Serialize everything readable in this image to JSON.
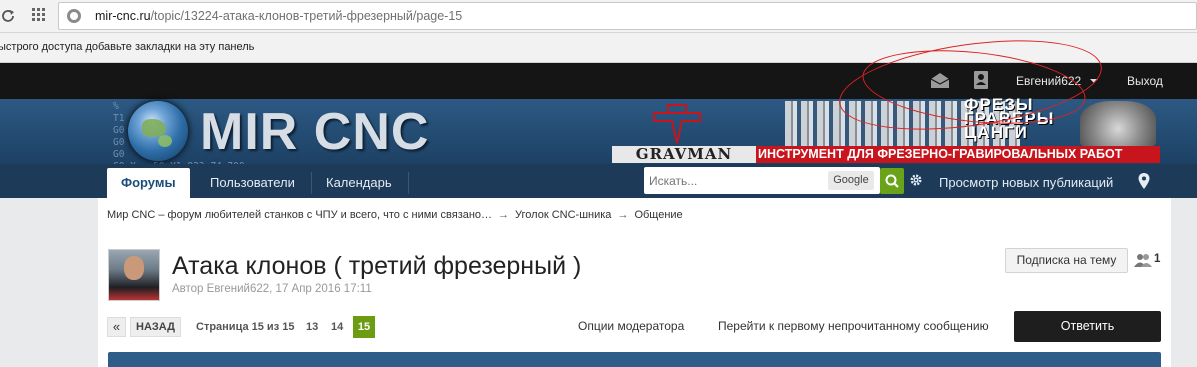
{
  "browser": {
    "url_domain": "mir-cnc.ru",
    "url_path": "/topic/13224-атака-клонов-третий-фрезерный/page-15",
    "bookmarks_hint": "ыстрого доступа добавьте закладки на эту панель"
  },
  "userbar": {
    "username": "Евгений622",
    "logout": "Выход"
  },
  "header": {
    "logo": "MIR CNC",
    "gcode_text": "%\nT1\nG0 \nG0 \nG0 \nG0 X   50 Y1.823 Z4.700",
    "ad_words": "ФРЕЗЫ\nГРАВЕРЫ\nЦАНГИ",
    "ad_brand": "GRAVMAN",
    "ad_tagline": "ИНСТРУМЕНТ ДЛЯ ФРЕЗЕРНО-ГРАВИРОВАЛЬНЫХ РАБОТ"
  },
  "nav": {
    "tabs": [
      {
        "label": "Форумы"
      },
      {
        "label": "Пользователи"
      },
      {
        "label": "Календарь"
      }
    ],
    "search_placeholder": "Искать...",
    "google_label": "Google",
    "view_new": "Просмотр новых публикаций"
  },
  "breadcrumb": {
    "items": [
      "Мир CNC – форум любителей станков с ЧПУ и всего, что с ними связано…",
      "Уголок CNC-шника",
      "Общение"
    ],
    "separator": "→"
  },
  "topic": {
    "title": "Атака клонов ( третий фрезерный )",
    "meta": "Автор Евгений622, 17 Апр 2016 17:11",
    "subscribe": "Подписка на тему",
    "followers": "1"
  },
  "pagination": {
    "prev": "«",
    "back": "НАЗАД",
    "info": "Страница 15 из 15",
    "pages": [
      "13",
      "14"
    ],
    "current": "15"
  },
  "actions": {
    "mod_options": "Опции модератора",
    "first_unread": "Перейти к первому непрочитанному сообщению",
    "reply": "Ответить"
  },
  "colors": {
    "annotation": "#dd2222",
    "accent_green": "#6b9c11",
    "header_blue": "#2c5984",
    "ad_red": "#c8141c"
  }
}
